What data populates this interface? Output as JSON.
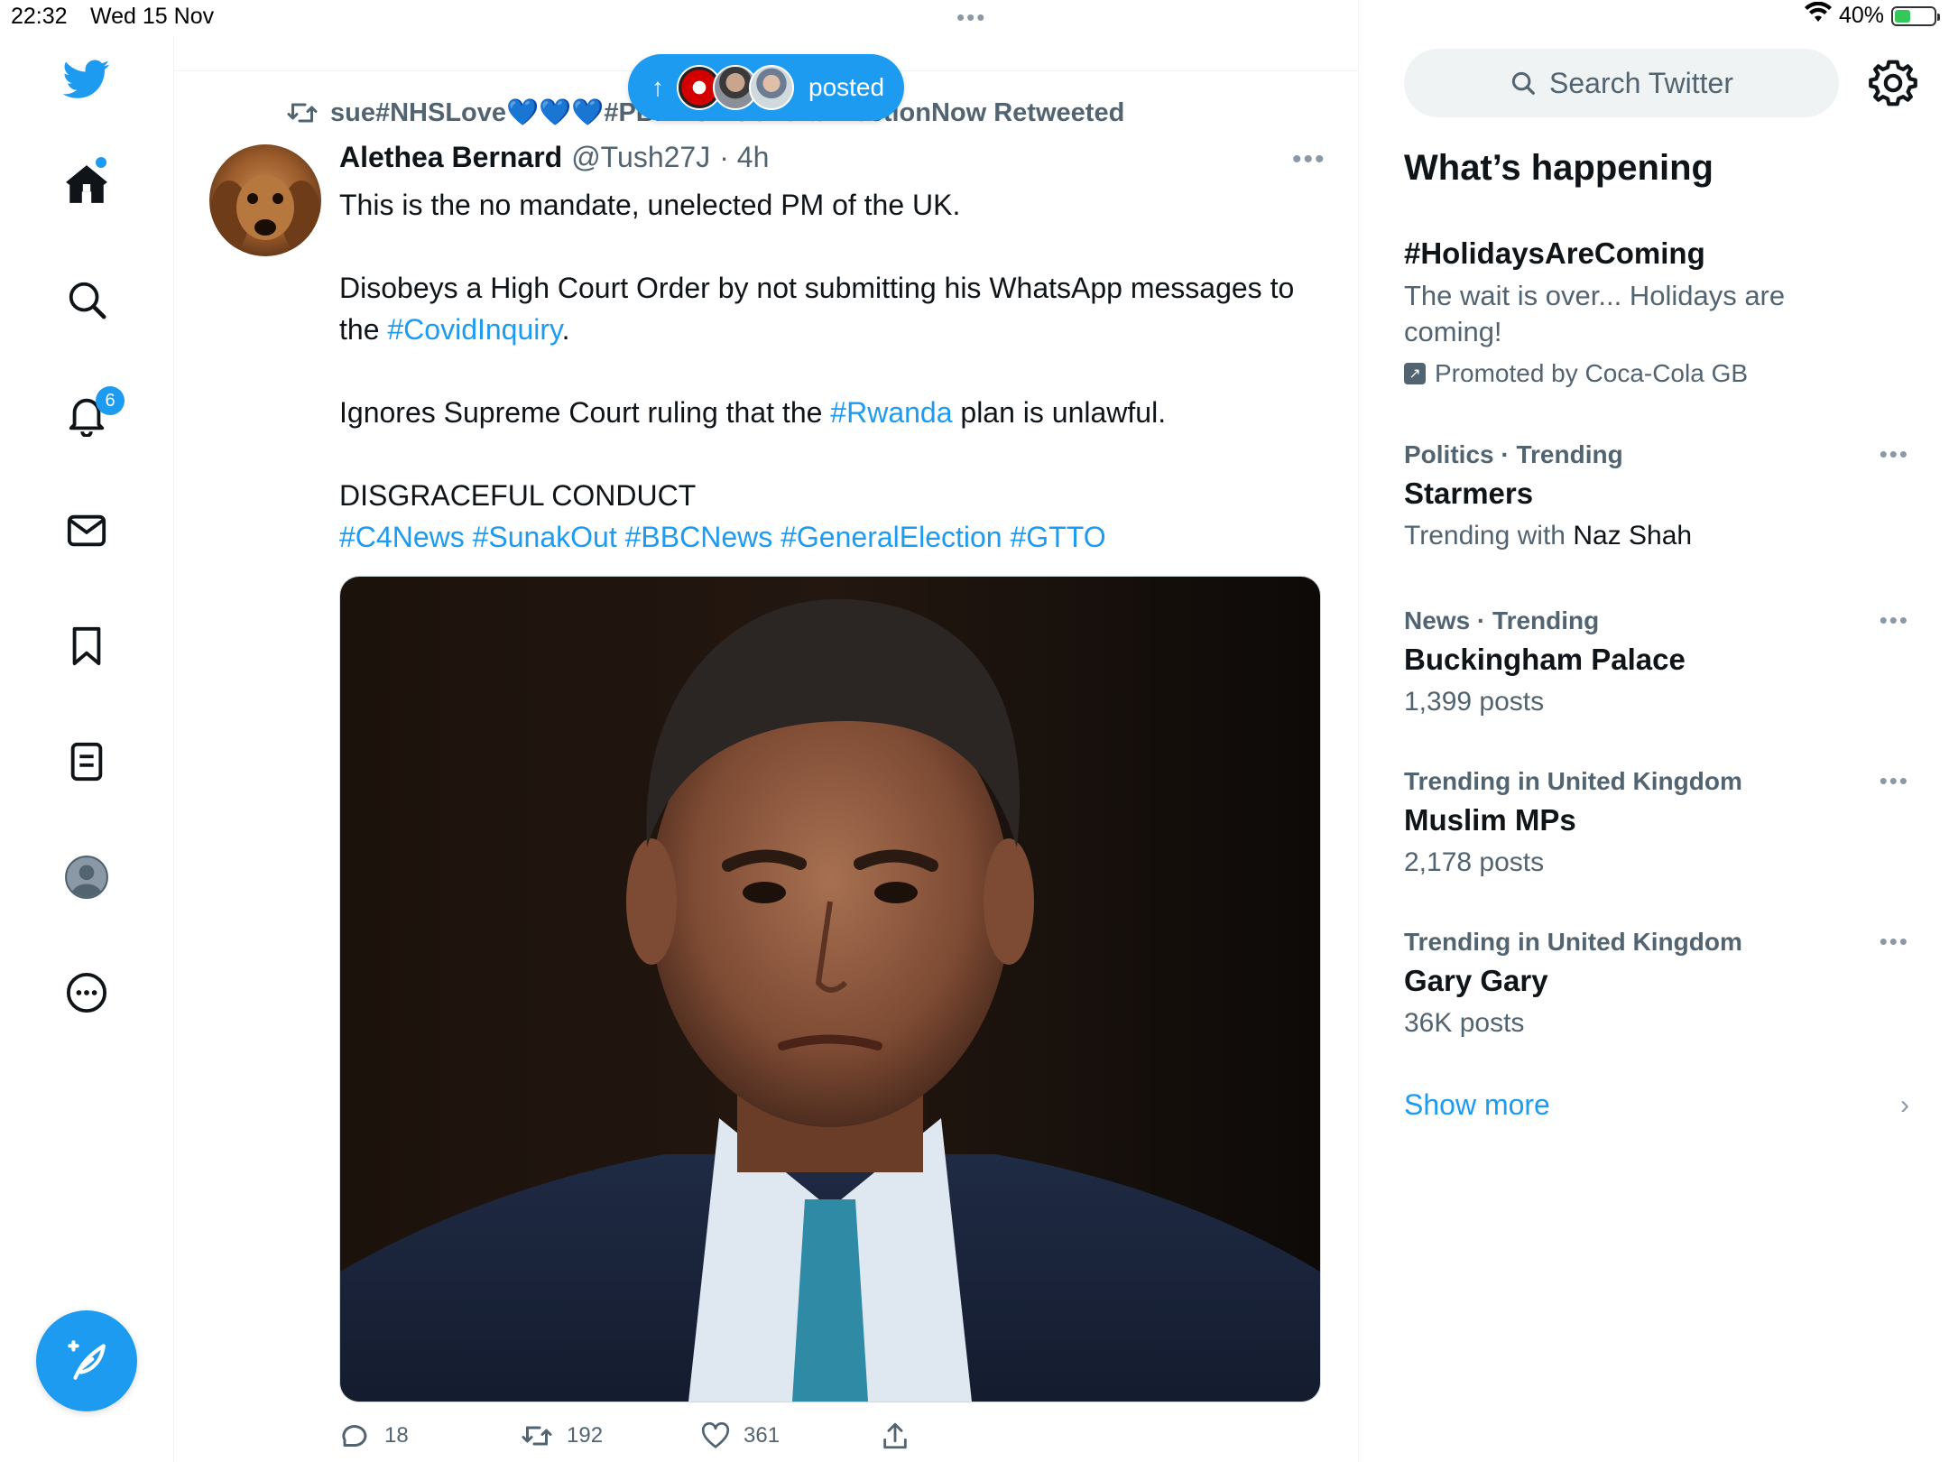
{
  "status_bar": {
    "time": "22:32",
    "date": "Wed 15 Nov",
    "battery": "40%",
    "battery_level": 0.4,
    "center_dots": "•••"
  },
  "sidebar": {
    "notifications_badge": "6",
    "items": [
      {
        "name": "home"
      },
      {
        "name": "explore"
      },
      {
        "name": "notifications"
      },
      {
        "name": "messages"
      },
      {
        "name": "bookmarks"
      },
      {
        "name": "lists"
      },
      {
        "name": "profile"
      },
      {
        "name": "more"
      }
    ]
  },
  "new_posts_pill": {
    "label": "posted",
    "arrow": "↑"
  },
  "tweet": {
    "retweeted_by": "sue#NHSLove💙💙💙#PBNHS #GeneralElectionNow Retweeted",
    "author": "Alethea Bernard",
    "handle": "@Tush27J",
    "time": "· 4h",
    "more": "•••",
    "p1": "This is the no mandate, unelected PM of the UK.",
    "p2_a": "Disobeys a High Court Order by not  submitting his WhatsApp messages to the ",
    "p2_link": "#CovidInquiry",
    "p2_b": ".",
    "p3_a": "Ignores Supreme Court ruling that the ",
    "p3_link": "#Rwanda",
    "p3_b": " plan is unlawful.",
    "p4": "DISGRACEFUL CONDUCT",
    "hashtags": "#C4News #SunakOut #BBCNews #GeneralElection #GTTO",
    "stats": {
      "replies": "18",
      "retweets": "192",
      "likes": "361"
    }
  },
  "right": {
    "search_placeholder": "Search Twitter",
    "whats_happening": "What’s happening",
    "promoted": {
      "title": "#HolidaysAreComing",
      "desc": "The wait is over... Holidays are coming!",
      "promoted_by": "Promoted by Coca-Cola GB"
    },
    "trends": [
      {
        "meta": "Politics · Trending",
        "title": "Starmers",
        "sub_a": "Trending with ",
        "sub_b": "Naz Shah"
      },
      {
        "meta": "News · Trending",
        "title": "Buckingham Palace",
        "sub_a": "1,399 posts",
        "sub_b": ""
      },
      {
        "meta": "Trending in United Kingdom",
        "title": "Muslim MPs",
        "sub_a": "2,178 posts",
        "sub_b": ""
      },
      {
        "meta": "Trending in United Kingdom",
        "title": "Gary Gary",
        "sub_a": "36K posts",
        "sub_b": ""
      }
    ],
    "trend_more": "•••",
    "show_more": "Show more",
    "chevron": "›"
  }
}
